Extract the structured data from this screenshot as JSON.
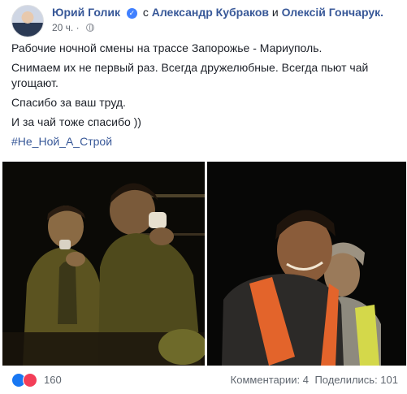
{
  "header": {
    "author": "Юрий Голик",
    "with_prefix": "с",
    "tagged_1": "Александр Кубраков",
    "conjunction": "и",
    "tagged_2": "Олексій Гончарук.",
    "time": "20 ч.",
    "dot": "·",
    "verified_icon": "verified-badge-icon",
    "privacy_icon": "globe-icon"
  },
  "post": {
    "line_1": "Рабочие ночной смены на трассе Запорожье - Мариуполь.",
    "line_2a": "Снимаем их не первый раз. Всегда дружелюбные. Всегда пьют чай",
    "line_2b": "угощают.",
    "line_3": "Спасибо за ваш труд.",
    "line_4": "И за чай тоже спасибо ))",
    "hashtag": "#Не_Ной_А_Строй"
  },
  "photos": [
    {
      "icon": "photo-road-workers-drinking-tea"
    },
    {
      "icon": "photo-road-workers-portrait"
    }
  ],
  "footer": {
    "reactions_count": "160",
    "comments": "Комментарии: 4",
    "shares": "Поделились: 101",
    "reaction_icons": [
      "like-icon",
      "love-icon"
    ]
  },
  "colors": {
    "link": "#385898",
    "meta": "#616770",
    "vest_orange": "#e3642b",
    "vest_yellow": "#d4d84a"
  }
}
